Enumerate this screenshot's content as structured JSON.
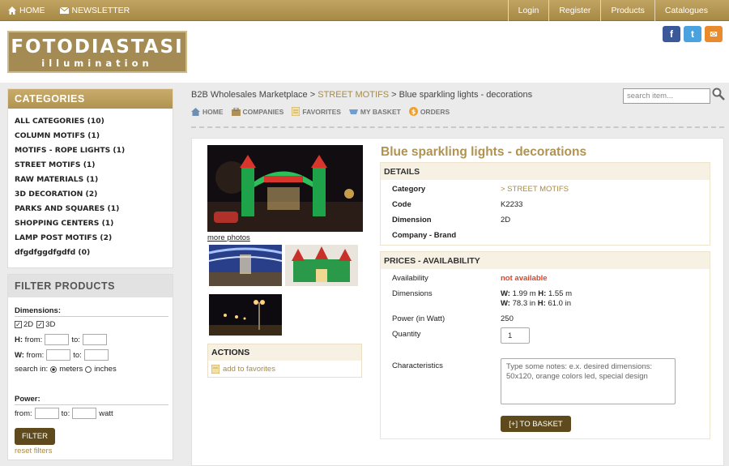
{
  "topbar": {
    "home": "HOME",
    "newsletter": "NEWSLETTER",
    "nav": [
      "Login",
      "Register",
      "Products",
      "Catalogues"
    ]
  },
  "logo": {
    "line1": "FOTODIASTASI",
    "line2": "illumination"
  },
  "social": [
    {
      "icon": "facebook-icon",
      "glyph": "f",
      "color": "#3b5998"
    },
    {
      "icon": "twitter-icon",
      "glyph": "t",
      "color": "#4aa3df"
    },
    {
      "icon": "email-icon",
      "glyph": "✉",
      "color": "#e98a2c"
    }
  ],
  "categories": {
    "title": "CATEGORIES",
    "items": [
      "ALL CATEGORIES (10)",
      "COLUMN MOTIFS (1)",
      "MOTIFS - ROPE LIGHTS (1)",
      "STREET MOTIFS (1)",
      "RAW MATERIALS (1)",
      "3D DECORATION (2)",
      "PARKS AND SQUARES (1)",
      "SHOPPING CENTERS (1)",
      "LAMP POST MOTIFS (2)",
      "dfgdfggdfgdfd (0)"
    ]
  },
  "filter": {
    "title": "FILTER PRODUCTS",
    "dimensions_label": "Dimensions:",
    "opt_2d": "2D",
    "opt_3d": "3D",
    "h_label": "H:",
    "w_label": "W:",
    "from": "from:",
    "to": "to:",
    "search_in": "search in:",
    "meters": "meters",
    "inches": "inches",
    "power_label": "Power:",
    "watt": "watt",
    "button": "FILTER",
    "reset": "reset filters"
  },
  "breadcrumb": {
    "root": "B2B Wholesales Marketplace",
    "sep": ">",
    "category": "STREET MOTIFS",
    "current": "Blue sparkling lights - decorations"
  },
  "search": {
    "placeholder": "search item..."
  },
  "subnav": [
    "HOME",
    "COMPANIES",
    "FAVORITES",
    "MY BASKET",
    "ORDERS"
  ],
  "product": {
    "title": "Blue sparkling lights - decorations",
    "more_photos": "more photos",
    "actions_title": "ACTIONS",
    "add_fav": "add to favorites",
    "details": {
      "title": "DETAILS",
      "category_label": "Category",
      "category_value": "> STREET MOTIFS",
      "code_label": "Code",
      "code_value": "K2233",
      "dimension_label": "Dimension",
      "dimension_value": "2D",
      "brand_label": "Company - Brand"
    },
    "prices": {
      "title": "PRICES - AVAILABILITY",
      "availability_label": "Availability",
      "availability_value": "not available",
      "dimensions_label": "Dimensions",
      "dim_w1_label": "W:",
      "dim_w1": "1.99 m",
      "dim_h1_label": "H:",
      "dim_h1": "1.55 m",
      "dim_w2_label": "W:",
      "dim_w2": "78.3 in",
      "dim_h2_label": "H:",
      "dim_h2": "61.0 in",
      "power_label": "Power (in Watt)",
      "power_value": "250",
      "quantity_label": "Quantity",
      "quantity_value": "1",
      "characteristics_label": "Characteristics",
      "notes_placeholder": "Type some notes: e.x. desired dimensions: 50x120, orange colors led, special design",
      "basket_button": "[+] TO BASKET"
    }
  },
  "colors": {
    "gold": "#b09350",
    "dark_button": "#5e4a1d",
    "alert": "#d9452b"
  }
}
